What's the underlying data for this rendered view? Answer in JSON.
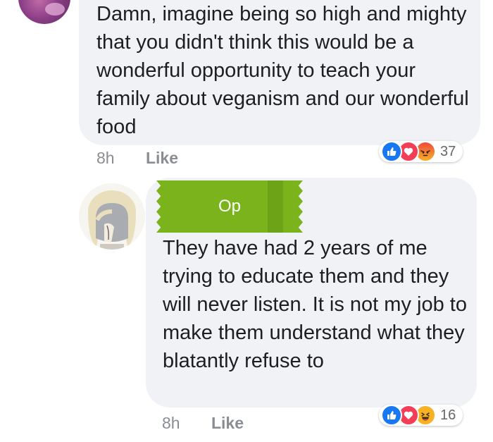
{
  "comments": [
    {
      "text": "Damn, imagine being so high and mighty that you didn't think this would be a wonderful opportunity to teach your family about veganism and our wonderful food",
      "time": "8h",
      "like_label": "Like",
      "reactions": [
        "like-icon",
        "love-icon",
        "angry-icon"
      ],
      "reaction_count": "37"
    },
    {
      "tag_label": "Op",
      "text": "They have had 2 years of me trying to educate them and they will never listen. It is not my job to make them understand what they blatantly refuse to",
      "time": "8h",
      "like_label": "Like",
      "reactions": [
        "like-icon",
        "love-icon",
        "haha-icon"
      ],
      "reaction_count": "16"
    }
  ],
  "colors": {
    "bubble": "#f0f2f5",
    "like_blue": "#1877f2",
    "love_red": "#f33e58",
    "reaction_yellow": "#f7b125",
    "op_tag_green": "#7ab31c"
  }
}
